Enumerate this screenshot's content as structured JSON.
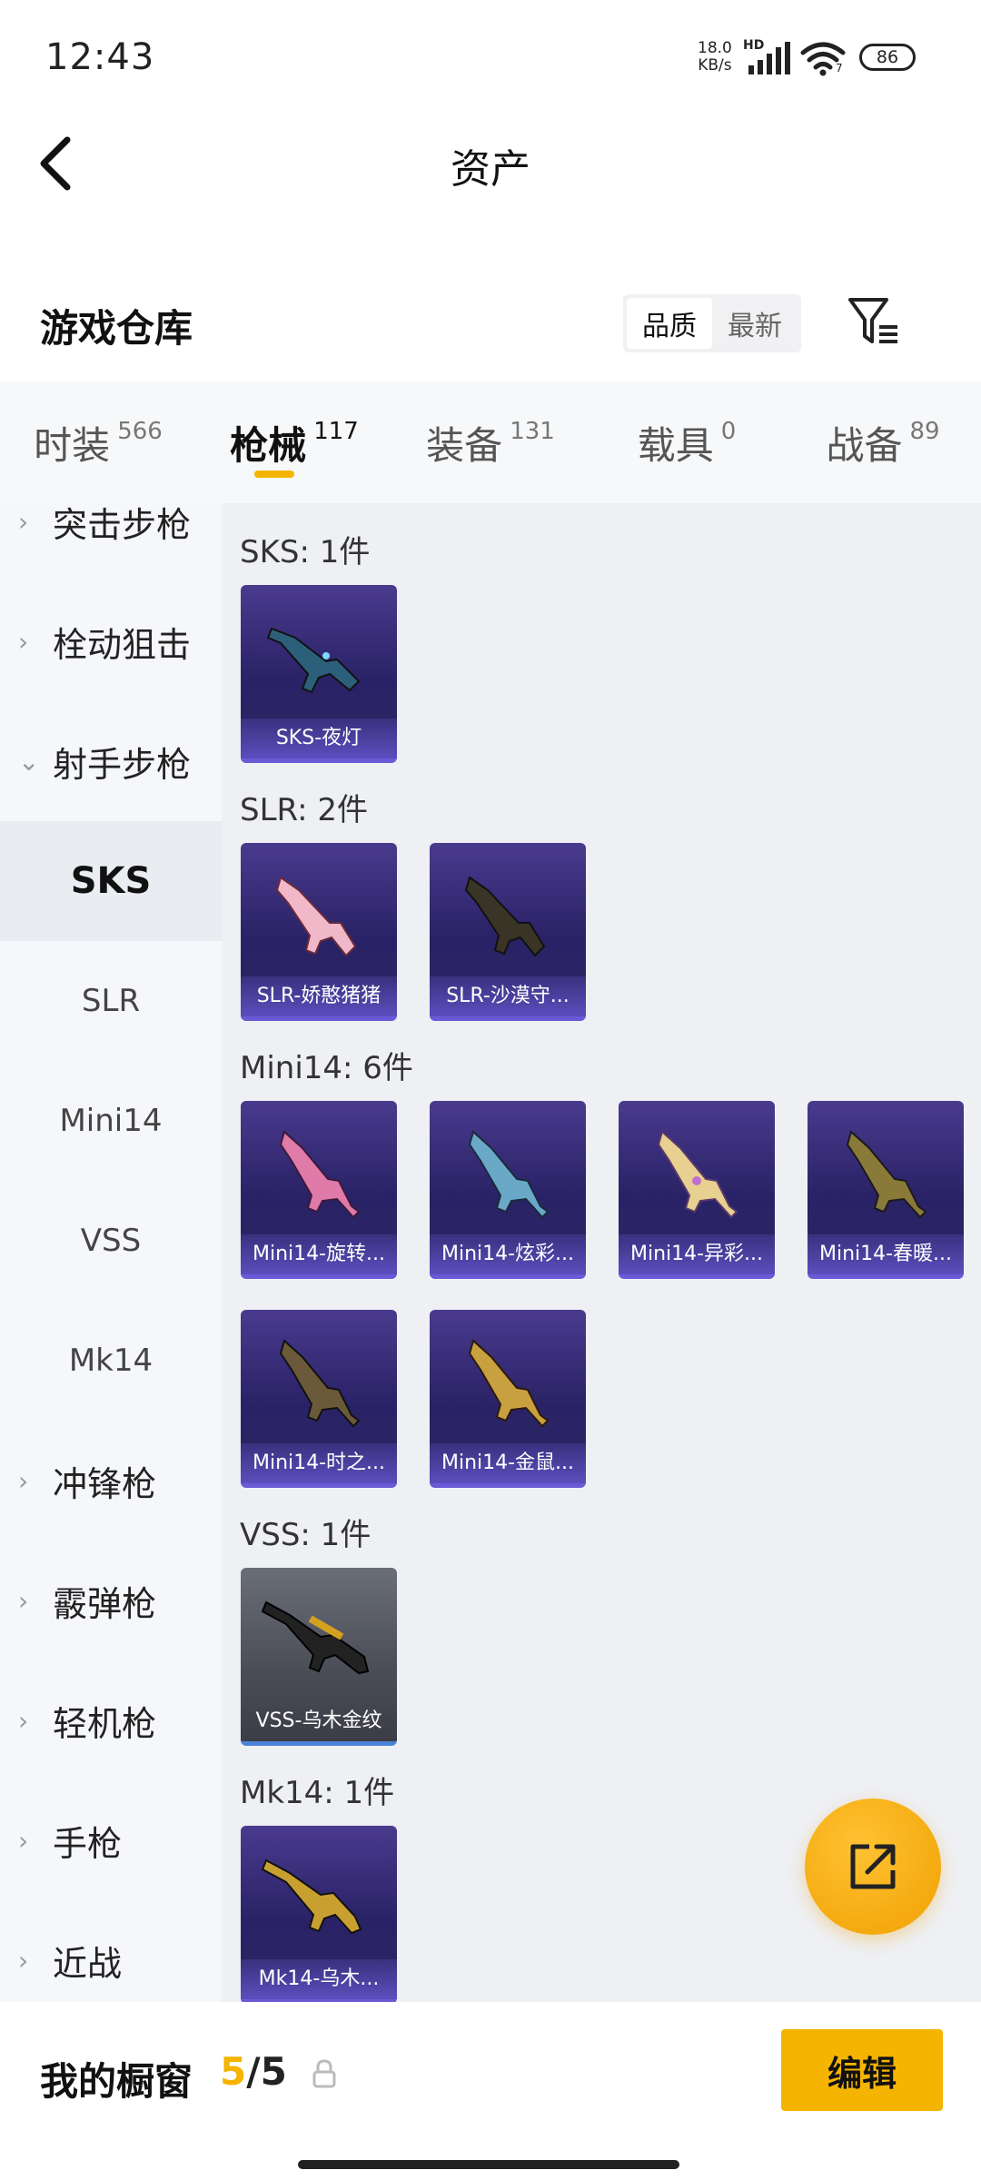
{
  "status_bar": {
    "time": "12:43",
    "net_speed": "18.0",
    "net_unit": "KB/s",
    "hd": "HD",
    "wifi_num": "7",
    "battery": "86"
  },
  "header": {
    "title": "资产"
  },
  "section": {
    "title": "游戏仓库",
    "sort_options": [
      "品质",
      "最新"
    ],
    "sort_active": "品质"
  },
  "tabs": [
    {
      "label": "时装",
      "count": "566"
    },
    {
      "label": "枪械",
      "count": "117",
      "active": true
    },
    {
      "label": "装备",
      "count": "131"
    },
    {
      "label": "载具",
      "count": "0"
    },
    {
      "label": "战备",
      "count": "89"
    }
  ],
  "sidebar": {
    "items": [
      {
        "label": "突击步枪",
        "type": "category"
      },
      {
        "label": "栓动狙击",
        "type": "category"
      },
      {
        "label": "射手步枪",
        "type": "category",
        "expanded": true
      },
      {
        "label": "SKS",
        "type": "sub",
        "active": true
      },
      {
        "label": "SLR",
        "type": "sub"
      },
      {
        "label": "Mini14",
        "type": "sub"
      },
      {
        "label": "VSS",
        "type": "sub"
      },
      {
        "label": "Mk14",
        "type": "sub"
      },
      {
        "label": "冲锋枪",
        "type": "category"
      },
      {
        "label": "霰弹枪",
        "type": "category"
      },
      {
        "label": "轻机枪",
        "type": "category"
      },
      {
        "label": "手枪",
        "type": "category"
      },
      {
        "label": "近战",
        "type": "category"
      }
    ]
  },
  "groups": [
    {
      "label": "SKS: 1件",
      "items": [
        "SKS-夜灯"
      ]
    },
    {
      "label": "SLR: 2件",
      "items": [
        "SLR-娇憨猪猪",
        "SLR-沙漠守..."
      ]
    },
    {
      "label": "Mini14: 6件",
      "items": [
        "Mini14-旋转...",
        "Mini14-炫彩...",
        "Mini14-异彩...",
        "Mini14-春暖...",
        "Mini14-时之...",
        "Mini14-金鼠..."
      ]
    },
    {
      "label": "VSS: 1件",
      "items": [
        "VSS-乌木金纹"
      ]
    },
    {
      "label": "Mk14: 1件",
      "items": [
        "Mk14-乌木..."
      ]
    }
  ],
  "colors": {
    "accent": "#f5b400",
    "card_purple": "#2a2266",
    "card_grey": "#4a4d56"
  },
  "showcase": {
    "label": "我的橱窗",
    "current": "5",
    "separator": "/",
    "total": "5",
    "edit_label": "编辑"
  }
}
